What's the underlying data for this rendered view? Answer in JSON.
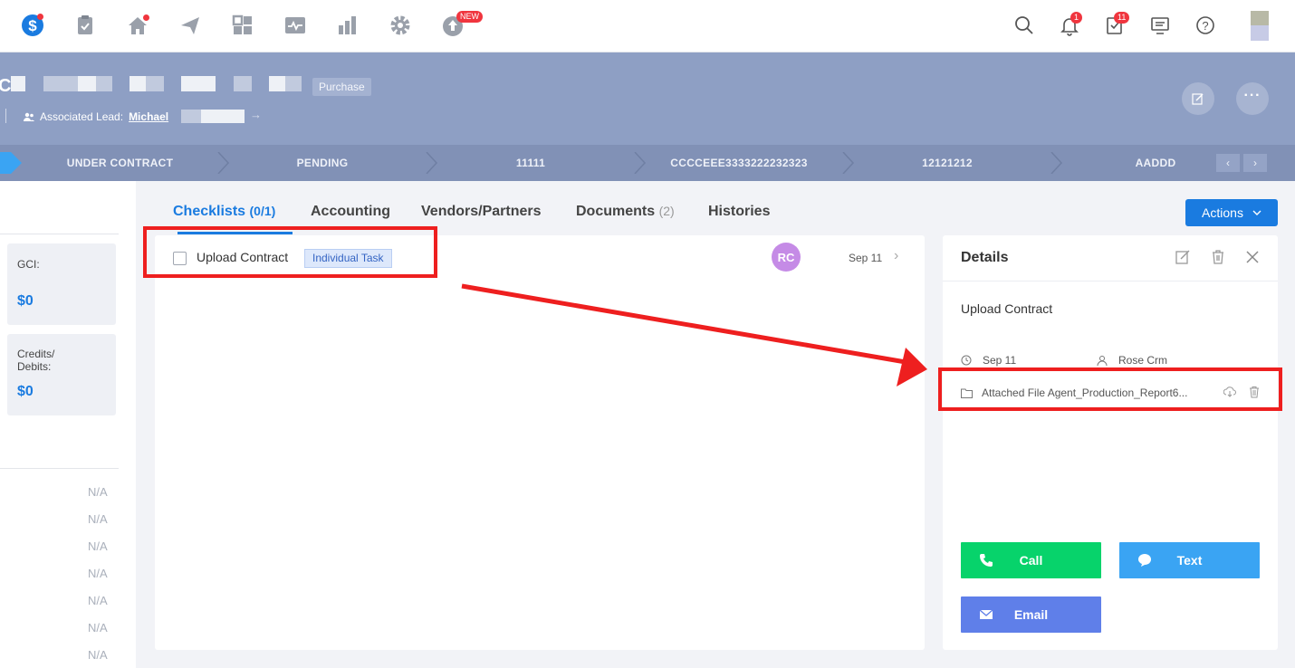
{
  "topnav": {
    "new_badge": "NEW",
    "notifications_count": "1",
    "tasks_count": "11"
  },
  "header": {
    "tag": "Purchase",
    "associated_lead_label": "Associated Lead:",
    "lead_name": "Michael",
    "partial_initial": "C"
  },
  "pipeline": {
    "stages": [
      "UNDER CONTRACT",
      "PENDING",
      "11111",
      "CCCCEEE3333222232323",
      "12121212",
      "AADDD"
    ]
  },
  "sidebar": {
    "gci_label": "GCI:",
    "gci_value": "$0",
    "credits_label_1": "Credits/",
    "credits_label_2": "Debits:",
    "credits_value": "$0",
    "na_values": [
      "N/A",
      "N/A",
      "N/A",
      "N/A",
      "N/A",
      "N/A",
      "N/A"
    ]
  },
  "tabs": {
    "checklists": "Checklists",
    "checklists_count": "(0/1)",
    "accounting": "Accounting",
    "vendors": "Vendors/Partners",
    "documents": "Documents",
    "documents_count": "(2)",
    "histories": "Histories"
  },
  "actions_label": "Actions",
  "task": {
    "name": "Upload Contract",
    "tag": "Individual Task",
    "assignee_initials": "RC",
    "date": "Sep 11"
  },
  "details": {
    "title": "Details",
    "task_name": "Upload Contract",
    "date": "Sep 11",
    "assignee": "Rose Crm",
    "attachment": "Attached File Agent_Production_Report6...",
    "call_label": "Call",
    "text_label": "Text",
    "email_label": "Email"
  },
  "colors": {
    "accent": "#1a7be0",
    "banner": "#8e9fc4",
    "call": "#07d36b",
    "text": "#3aa4f3",
    "email": "#5f7fe9",
    "annotation": "#ee1f1f"
  }
}
